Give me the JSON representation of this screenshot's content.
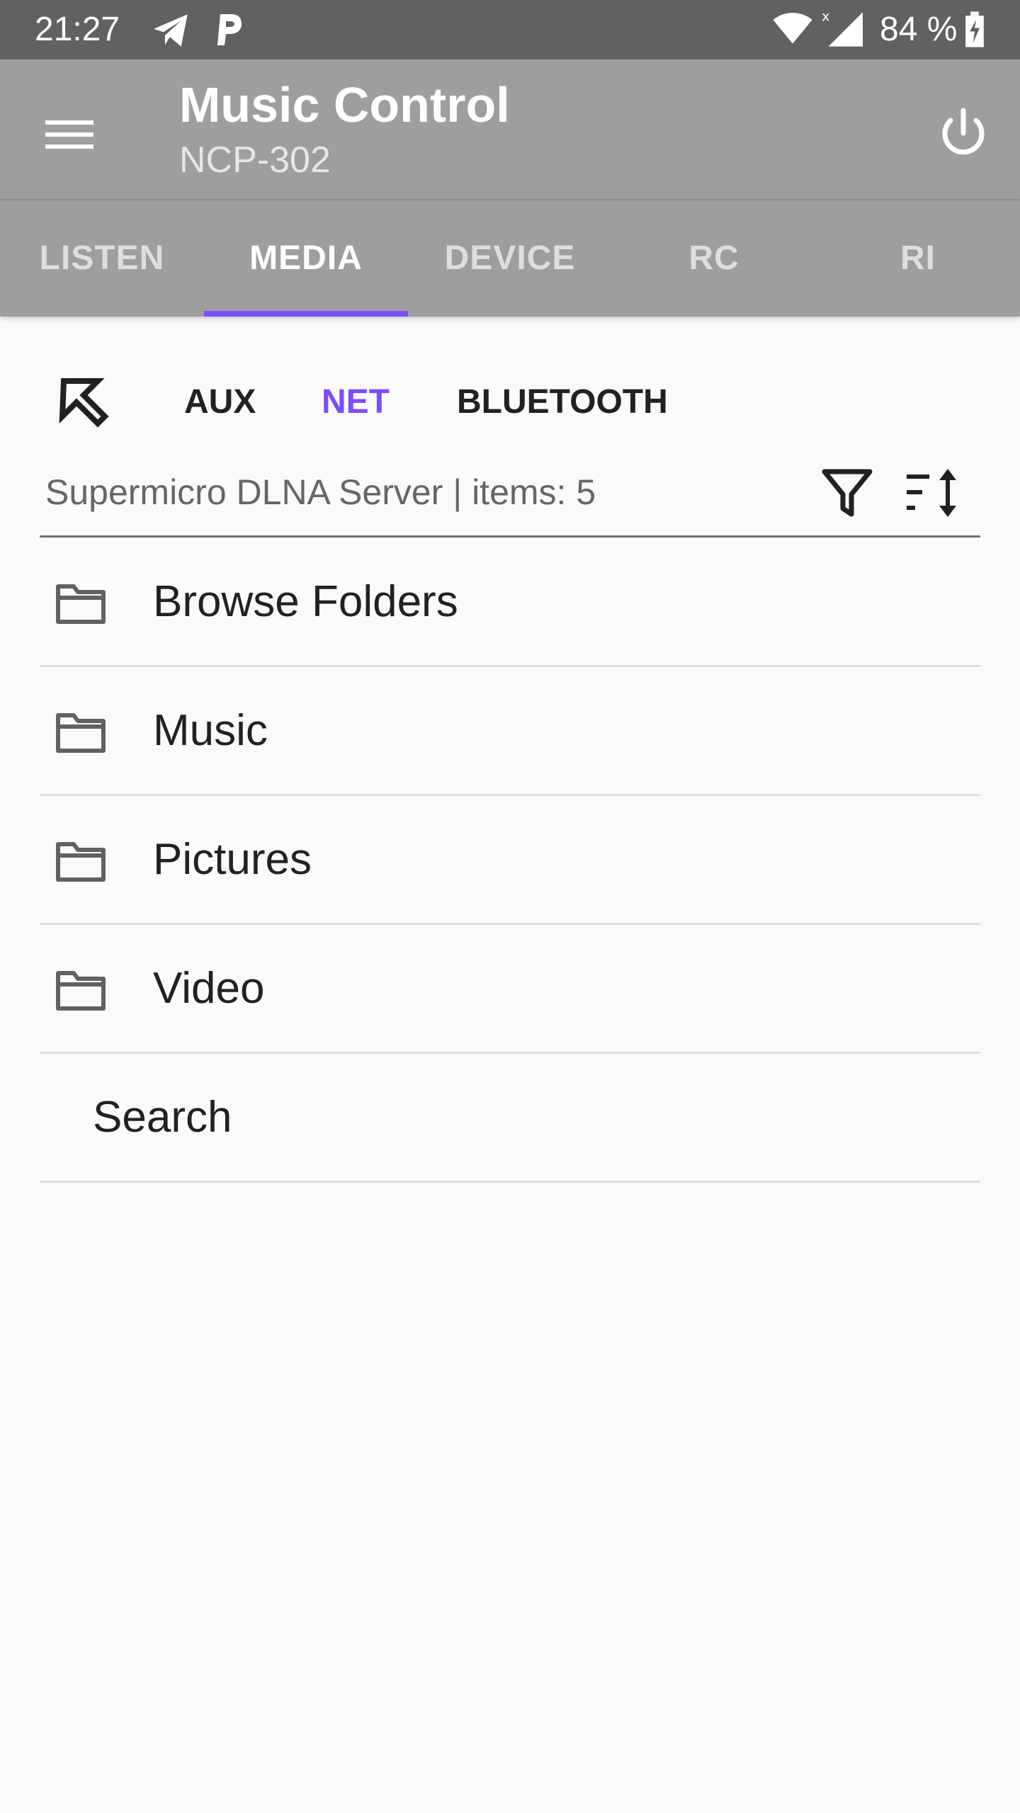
{
  "status_bar": {
    "time": "21:27",
    "battery": "84 %",
    "icons": [
      "telegram-icon",
      "p-app-icon",
      "wifi-icon",
      "cell-signal-icon",
      "battery-charging-icon"
    ]
  },
  "app_bar": {
    "title": "Music Control",
    "subtitle": "NCP-302",
    "menu_icon": "hamburger-menu-icon",
    "power_icon": "power-icon"
  },
  "tabs": [
    {
      "label": "LISTEN",
      "active": false
    },
    {
      "label": "MEDIA",
      "active": true
    },
    {
      "label": "DEVICE",
      "active": false
    },
    {
      "label": "RC",
      "active": false
    },
    {
      "label": "RI",
      "active": false
    }
  ],
  "sources": {
    "back_icon": "arrow-up-left-icon",
    "items": [
      {
        "label": "AUX",
        "active": false
      },
      {
        "label": "NET",
        "active": true
      },
      {
        "label": "BLUETOOTH",
        "active": false
      }
    ]
  },
  "server": {
    "info": "Supermicro DLNA Server | items: 5",
    "filter_icon": "filter-icon",
    "sort_icon": "sort-icon"
  },
  "media_list": [
    {
      "label": "Browse Folders",
      "icon": "folder-icon"
    },
    {
      "label": "Music",
      "icon": "folder-icon"
    },
    {
      "label": "Pictures",
      "icon": "folder-icon"
    },
    {
      "label": "Video",
      "icon": "folder-icon"
    },
    {
      "label": "Search",
      "icon": ""
    }
  ],
  "colors": {
    "status_bar": "#616161",
    "app_bar": "#9e9e9e",
    "accent": "#7c4dff",
    "background": "#fafafa"
  }
}
